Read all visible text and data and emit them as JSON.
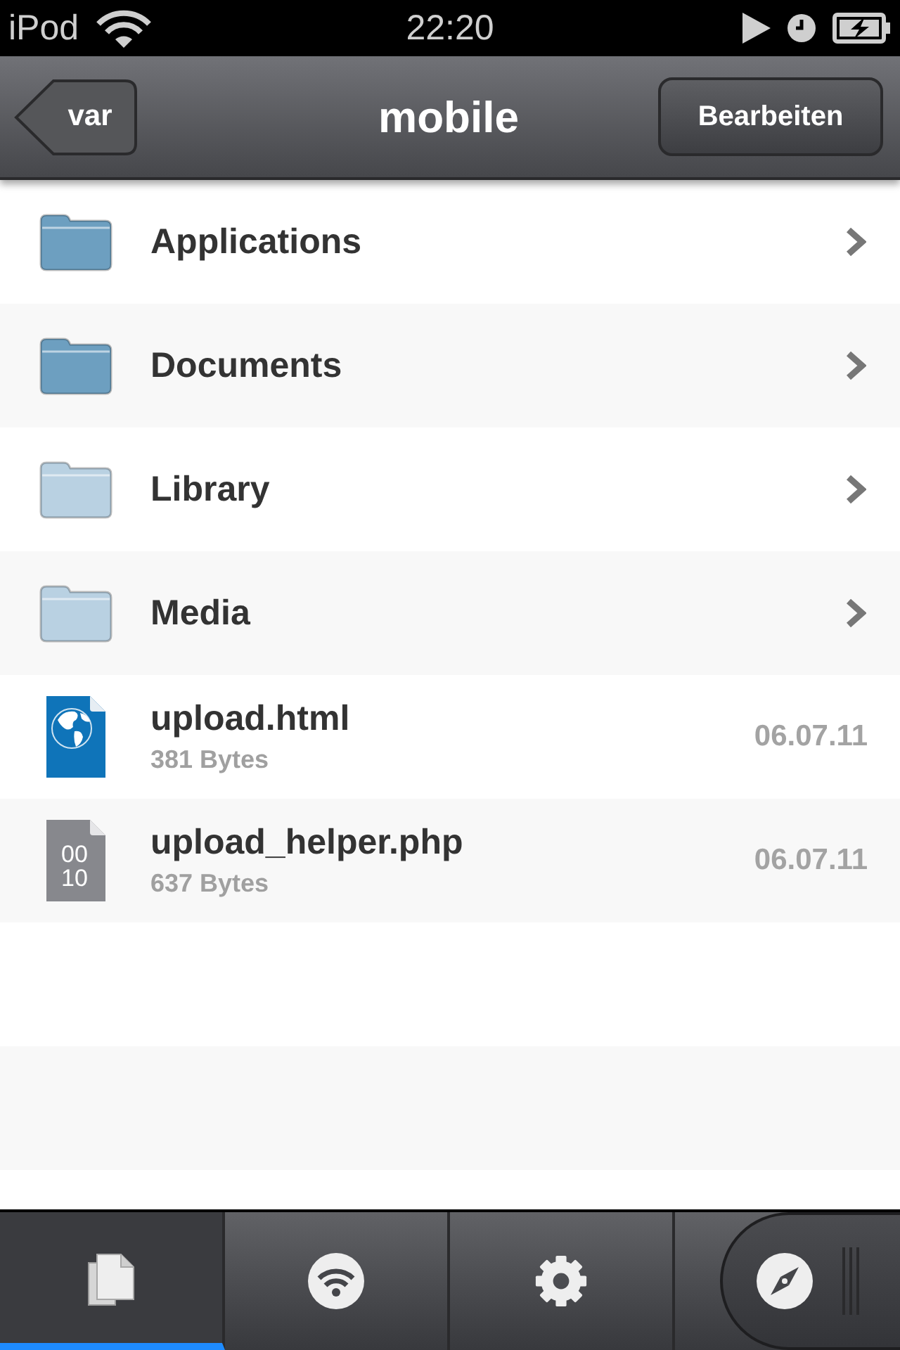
{
  "status_bar": {
    "device": "iPod",
    "time": "22:20"
  },
  "nav_bar": {
    "back_button": "var",
    "title": "mobile",
    "edit_button": "Bearbeiten"
  },
  "items": [
    {
      "kind": "folder",
      "name": "Applications",
      "color": "#6d9fc0"
    },
    {
      "kind": "folder",
      "name": "Documents",
      "color": "#6d9fc0"
    },
    {
      "kind": "folder",
      "name": "Library",
      "color": "#b9d1e2"
    },
    {
      "kind": "folder",
      "name": "Media",
      "color": "#b9d1e2"
    },
    {
      "kind": "webpage",
      "name": "upload.html",
      "size": "381 Bytes",
      "date": "06.07.11"
    },
    {
      "kind": "binary",
      "name": "upload_helper.php",
      "size": "637 Bytes",
      "date": "06.07.11",
      "icon_text": [
        "00",
        "10"
      ]
    }
  ],
  "tab_bar": {
    "tabs": [
      {
        "kind": "files",
        "selected": true
      },
      {
        "kind": "wifi",
        "selected": false
      },
      {
        "kind": "settings",
        "selected": false
      },
      {
        "kind": "compass",
        "selected": false
      }
    ]
  }
}
